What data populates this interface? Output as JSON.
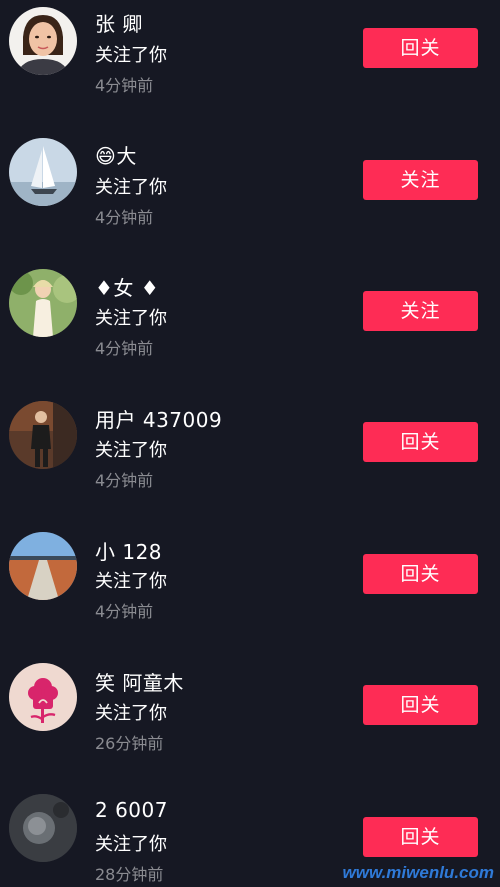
{
  "colors": {
    "background": "#161823",
    "button": "#fe2c55",
    "secondary_text": "#8a8b91"
  },
  "followers": [
    {
      "name": "张 卿",
      "action": "关注了你",
      "time": "4分钟前",
      "button_label": "回关",
      "avatar_icon": "woman-portrait-avatar"
    },
    {
      "name": "😄大 ",
      "action": "关注了你",
      "time": "4分钟前",
      "button_label": "关注",
      "avatar_icon": "sailboat-avatar"
    },
    {
      "name": "♦女 ♦",
      "action": "关注了你",
      "time": "4分钟前",
      "button_label": "关注",
      "avatar_icon": "woman-in-garden-avatar"
    },
    {
      "name": "用户 437009",
      "action": "关注了你",
      "time": "4分钟前",
      "button_label": "回关",
      "avatar_icon": "standing-person-avatar"
    },
    {
      "name": "小 128",
      "action": "关注了你",
      "time": "4分钟前",
      "button_label": "回关",
      "avatar_icon": "landscape-path-avatar"
    },
    {
      "name": "笑 阿童木",
      "action": "关注了你",
      "time": "26分钟前",
      "button_label": "回关",
      "avatar_icon": "pink-flower-logo-avatar"
    },
    {
      "name": "2 6007",
      "action": "关注了你",
      "time": "28分钟前",
      "button_label": "回关",
      "avatar_icon": "dark-gray-avatar"
    }
  ],
  "watermark": "www.miwenlu.com"
}
